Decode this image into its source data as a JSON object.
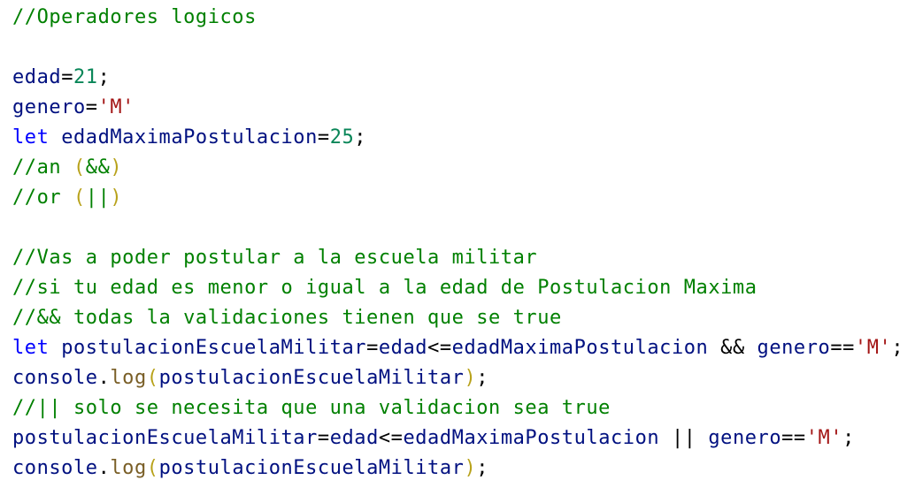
{
  "colors": {
    "comment": "#008000",
    "keyword": "#0000ff",
    "variable": "#001080",
    "number": "#098658",
    "string": "#a31515",
    "function": "#795e26",
    "bracket": "#b8a21b",
    "plain": "#000000",
    "background": "#ffffff"
  },
  "lines": [
    [
      {
        "t": "//Operadores logicos",
        "k": "comment"
      }
    ],
    [],
    [
      {
        "t": "edad",
        "k": "var"
      },
      {
        "t": "=",
        "k": "op"
      },
      {
        "t": "21",
        "k": "num"
      },
      {
        "t": ";",
        "k": "op"
      }
    ],
    [
      {
        "t": "genero",
        "k": "var"
      },
      {
        "t": "=",
        "k": "op"
      },
      {
        "t": "'M'",
        "k": "str"
      }
    ],
    [
      {
        "t": "let",
        "k": "keyword"
      },
      {
        "t": " ",
        "k": "plain"
      },
      {
        "t": "edadMaximaPostulacion",
        "k": "var"
      },
      {
        "t": "=",
        "k": "op"
      },
      {
        "t": "25",
        "k": "num"
      },
      {
        "t": ";",
        "k": "op"
      }
    ],
    [
      {
        "t": "//an ",
        "k": "comment"
      },
      {
        "t": "(",
        "k": "paren"
      },
      {
        "t": "&&",
        "k": "comment"
      },
      {
        "t": ")",
        "k": "paren"
      }
    ],
    [
      {
        "t": "//or ",
        "k": "comment"
      },
      {
        "t": "(",
        "k": "paren"
      },
      {
        "t": "||",
        "k": "comment"
      },
      {
        "t": ")",
        "k": "paren"
      }
    ],
    [],
    [
      {
        "t": "//Vas a poder postular a la escuela militar",
        "k": "comment"
      }
    ],
    [
      {
        "t": "//si tu edad es menor o igual a la edad de Postulacion Maxima",
        "k": "comment"
      }
    ],
    [
      {
        "t": "//&& todas la validaciones tienen que se true",
        "k": "comment"
      }
    ],
    [
      {
        "t": "let",
        "k": "keyword"
      },
      {
        "t": " ",
        "k": "plain"
      },
      {
        "t": "postulacionEscuelaMilitar",
        "k": "var"
      },
      {
        "t": "=",
        "k": "op"
      },
      {
        "t": "edad",
        "k": "var"
      },
      {
        "t": "<=",
        "k": "op"
      },
      {
        "t": "edadMaximaPostulacion",
        "k": "var"
      },
      {
        "t": " && ",
        "k": "op"
      },
      {
        "t": "genero",
        "k": "var"
      },
      {
        "t": "==",
        "k": "op"
      },
      {
        "t": "'M'",
        "k": "str"
      },
      {
        "t": ";",
        "k": "op"
      }
    ],
    [
      {
        "t": "console",
        "k": "var"
      },
      {
        "t": ".",
        "k": "op"
      },
      {
        "t": "log",
        "k": "fn"
      },
      {
        "t": "(",
        "k": "paren"
      },
      {
        "t": "postulacionEscuelaMilitar",
        "k": "var"
      },
      {
        "t": ")",
        "k": "paren"
      },
      {
        "t": ";",
        "k": "op"
      }
    ],
    [
      {
        "t": "//|| solo se necesita que una validacion sea true",
        "k": "comment"
      }
    ],
    [
      {
        "t": "postulacionEscuelaMilitar",
        "k": "var"
      },
      {
        "t": "=",
        "k": "op"
      },
      {
        "t": "edad",
        "k": "var"
      },
      {
        "t": "<=",
        "k": "op"
      },
      {
        "t": "edadMaximaPostulacion",
        "k": "var"
      },
      {
        "t": " || ",
        "k": "op"
      },
      {
        "t": "genero",
        "k": "var"
      },
      {
        "t": "==",
        "k": "op"
      },
      {
        "t": "'M'",
        "k": "str"
      },
      {
        "t": ";",
        "k": "op"
      }
    ],
    [
      {
        "t": "console",
        "k": "var"
      },
      {
        "t": ".",
        "k": "op"
      },
      {
        "t": "log",
        "k": "fn"
      },
      {
        "t": "(",
        "k": "paren"
      },
      {
        "t": "postulacionEscuelaMilitar",
        "k": "var"
      },
      {
        "t": ")",
        "k": "paren"
      },
      {
        "t": ";",
        "k": "op"
      }
    ]
  ]
}
